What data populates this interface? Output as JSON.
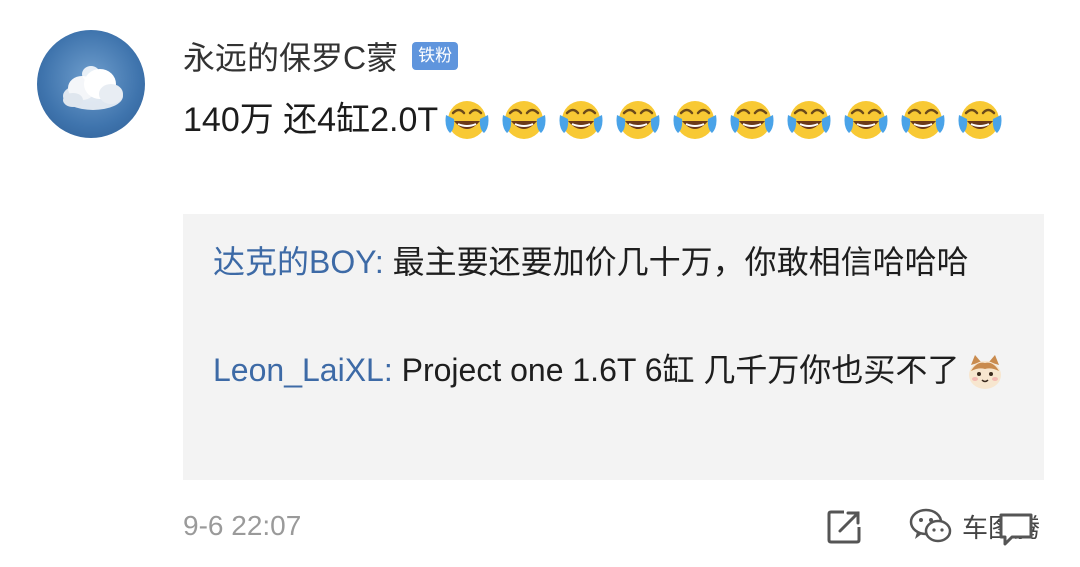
{
  "comment": {
    "username": "永远的保罗C蒙",
    "badge": "铁粉",
    "text": "140万 还4缸2.0T",
    "emoji_icon": "tears-of-joy-emoji",
    "emoji_count": 10,
    "timestamp": "9-6 22:07"
  },
  "replies": [
    {
      "user": "达克的BOY",
      "separator": ": ",
      "text": "最主要还要加价几十万，你敢相信哈哈哈"
    },
    {
      "user": "Leon_LaiXL",
      "separator": ": ",
      "text": "Project one 1.6T 6缸 几千万你也买不了",
      "emoji_icon": "cat-face-emoji"
    }
  ],
  "watermark": {
    "text": "车图腾",
    "icon": "wechat-icon"
  },
  "colors": {
    "link_blue": "#3d6aa6",
    "badge_blue": "#5f95dd",
    "reply_background": "#f3f3f3",
    "muted_text": "#9a9a9a"
  }
}
